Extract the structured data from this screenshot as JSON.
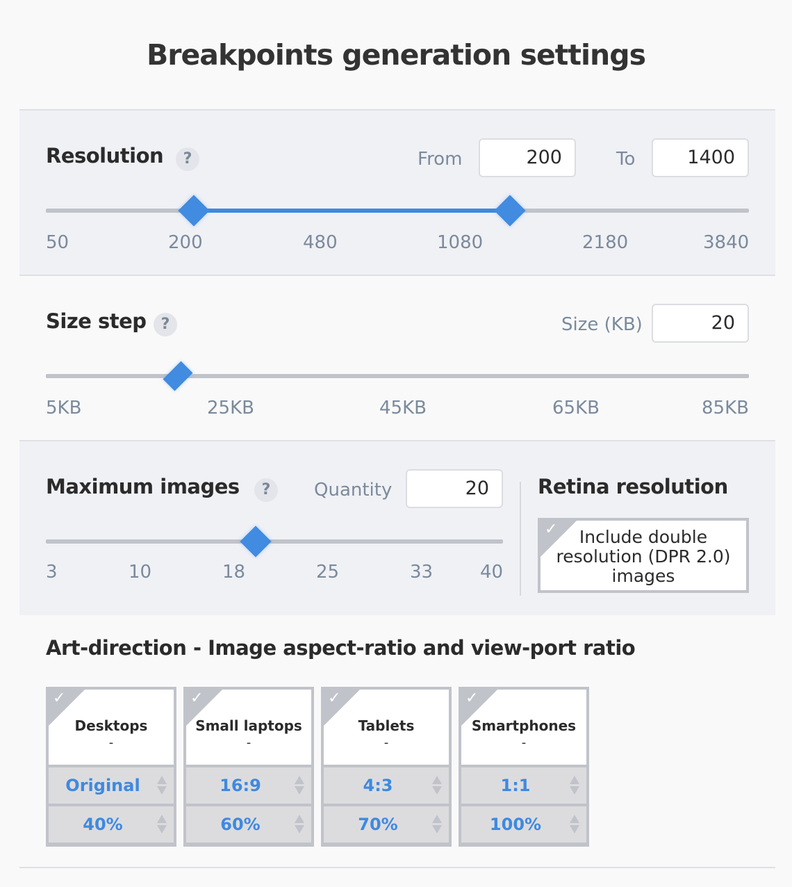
{
  "page": {
    "title": "Breakpoints generation settings"
  },
  "colors": {
    "accent": "#418be0",
    "track": "#c1c3ca",
    "label": "#7b8a9c",
    "text": "#2b2b2b"
  },
  "resolution": {
    "title": "Resolution",
    "help_icon": "?",
    "from_label": "From",
    "from_value": "200",
    "to_label": "To",
    "to_value": "1400",
    "ticks": [
      "50",
      "200",
      "480",
      "1080",
      "2180",
      "3840"
    ],
    "range_start_fraction": 0.21,
    "range_end_fraction": 0.66
  },
  "size_step": {
    "title": "Size step",
    "help_icon": "?",
    "size_label": "Size (KB)",
    "size_value": "20",
    "ticks": [
      "5KB",
      "25KB",
      "45KB",
      "65KB",
      "85KB"
    ],
    "value_fraction": 0.1875
  },
  "max_images": {
    "title": "Maximum images",
    "help_icon": "?",
    "quantity_label": "Quantity",
    "quantity_value": "20",
    "ticks": [
      "3",
      "10",
      "18",
      "25",
      "33",
      "40"
    ],
    "value_fraction": 0.459
  },
  "retina": {
    "title": "Retina resolution",
    "checkbox_label": "Include double resolution (DPR 2.0) images",
    "checked": true,
    "check_icon": "✓"
  },
  "art_direction": {
    "title": "Art-direction - Image aspect-ratio and view-port ratio",
    "check_icon": "✓",
    "cards": [
      {
        "name": "Desktops",
        "sub": "-",
        "aspect": "Original",
        "viewport": "40%"
      },
      {
        "name": "Small laptops",
        "sub": "-",
        "aspect": "16:9",
        "viewport": "60%"
      },
      {
        "name": "Tablets",
        "sub": "-",
        "aspect": "4:3",
        "viewport": "70%"
      },
      {
        "name": "Smartphones",
        "sub": "-",
        "aspect": "1:1",
        "viewport": "100%"
      }
    ]
  }
}
